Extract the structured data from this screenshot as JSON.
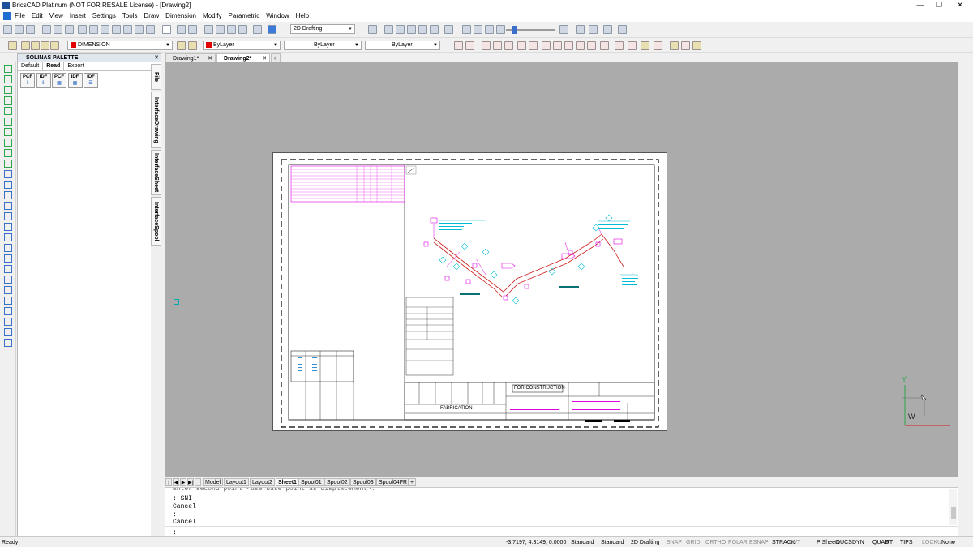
{
  "window": {
    "title": "BricsCAD Platinum (NOT FOR RESALE License) - [Drawing2]",
    "minimize": "—",
    "maximize": "❐",
    "close": "✕"
  },
  "menu": [
    "File",
    "Edit",
    "View",
    "Insert",
    "Settings",
    "Tools",
    "Draw",
    "Dimension",
    "Modify",
    "Parametric",
    "Window",
    "Help"
  ],
  "toolbar1": {
    "workspace": "2D Drafting"
  },
  "toolbar2": {
    "layer": "DIMENSION",
    "color": "ByLayer",
    "linetype": "ByLayer",
    "lineweight": "ByLayer"
  },
  "palette": {
    "title": "SOLINAS PALETTE",
    "close": "✕",
    "tabs": [
      "Default",
      "Read",
      "Export"
    ],
    "active_tab": "Read",
    "buttons": [
      {
        "top": "PCF",
        "bottom": "⇩"
      },
      {
        "top": "IDF",
        "bottom": "⇩"
      },
      {
        "top": "PCF",
        "bottom": "▦"
      },
      {
        "top": "IDF",
        "bottom": "▦"
      },
      {
        "top": "IDF",
        "bottom": "☰"
      }
    ],
    "side_tabs": [
      "File",
      "InterfaceDrawing",
      "InterfaceSheet",
      "InterfaceSpool"
    ]
  },
  "doc_tabs": [
    {
      "label": "Drawing1*",
      "close": "✕"
    },
    {
      "label": "Drawing2*",
      "close": "✕",
      "active": true
    },
    {
      "label": "+"
    }
  ],
  "sheet": {
    "stamp": "FOR CONSTRUCTION",
    "fabrication": "FABRICATION",
    "ucs_y": "Y",
    "ucs_w": "W"
  },
  "layout_tabs": [
    "Model",
    "Layout1",
    "Layout2",
    "Sheet1",
    "Spool01",
    "Spool02",
    "Spool03",
    "Spool04FR",
    "+"
  ],
  "active_layout": "Sheet1",
  "layout_nav": [
    "|◀",
    "◀",
    "▶",
    "▶|"
  ],
  "command_lines": [
    ": SNI",
    "Cancel",
    ":",
    "Cancel"
  ],
  "command_partial": "Enter second point <use base point as displacement>:",
  "command_prompt": ":",
  "status": {
    "ready": "Ready",
    "coords": "-3.7197, 4.3149, 0.0000",
    "items": [
      "Standard",
      "Standard",
      "2D Drafting",
      "SNAP",
      "GRID",
      "ORTHO",
      "POLAR",
      "ESNAP",
      "STRACK",
      "LWT",
      "P:Sheet1",
      "DUCS",
      "DYN",
      "QUAD",
      "RT",
      "TIPS",
      "LOCKUI",
      "None"
    ]
  },
  "colors": {
    "canvas": "#ababab",
    "magenta": "#e000e0",
    "cyan": "#00bcd4",
    "red": "#e00000",
    "green": "#2aa84a",
    "teal": "#0a7070"
  }
}
